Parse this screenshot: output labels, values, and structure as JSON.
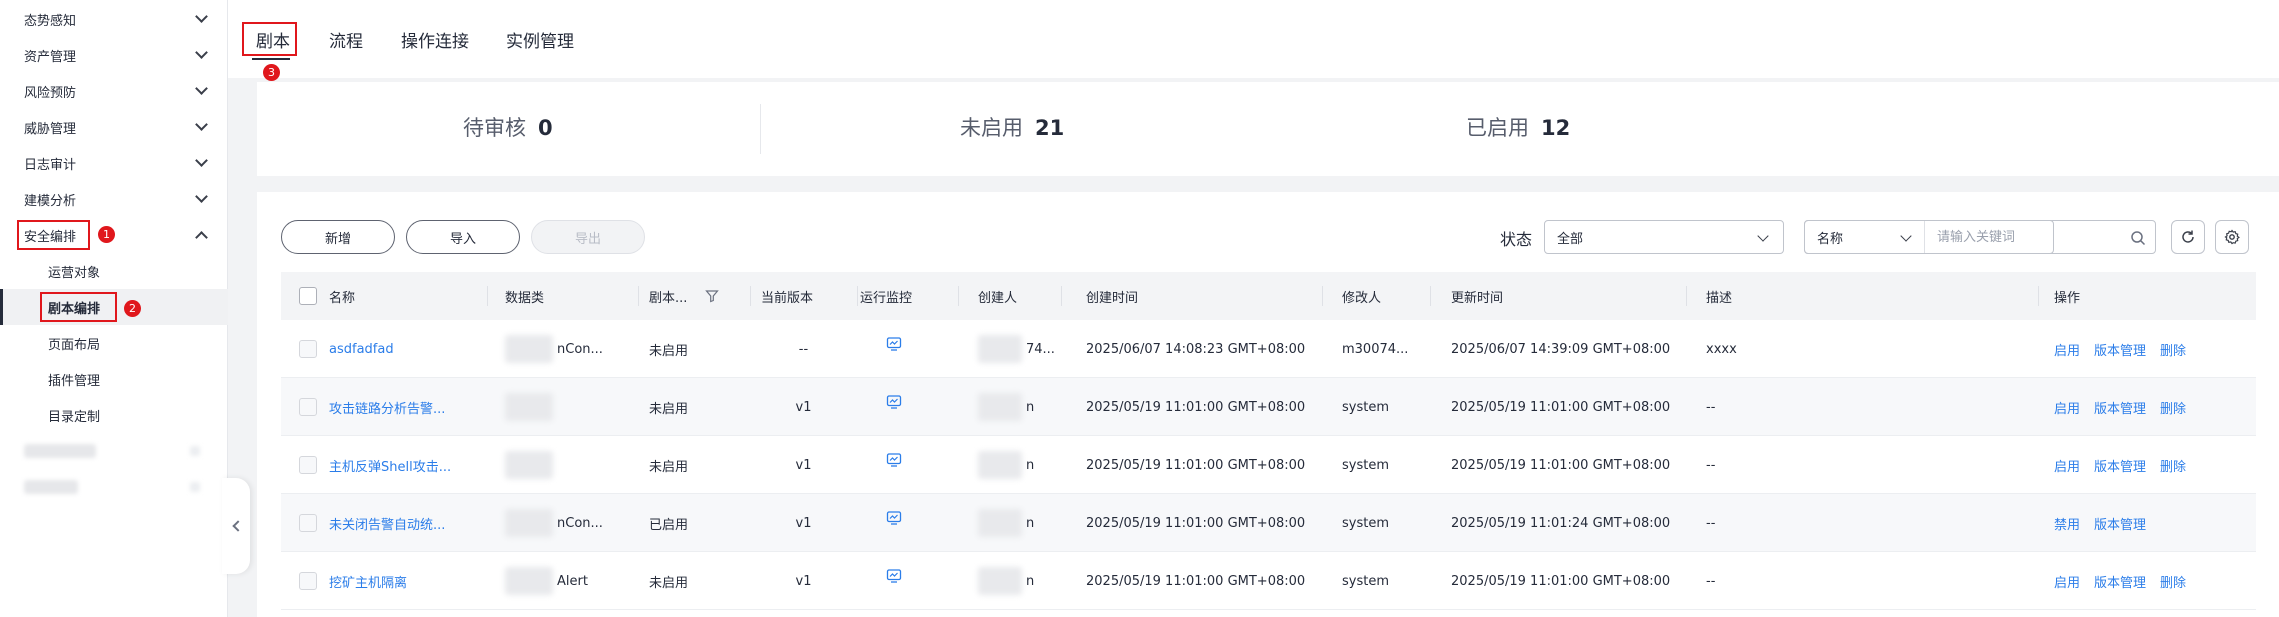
{
  "sidebar": {
    "items": [
      {
        "label": "态势感知"
      },
      {
        "label": "资产管理"
      },
      {
        "label": "风险预防"
      },
      {
        "label": "威胁管理"
      },
      {
        "label": "日志审计"
      },
      {
        "label": "建模分析"
      },
      {
        "label": "安全编排"
      }
    ],
    "subitems": [
      {
        "label": "运营对象"
      },
      {
        "label": "剧本编排"
      },
      {
        "label": "页面布局"
      },
      {
        "label": "插件管理"
      },
      {
        "label": "目录定制"
      }
    ],
    "active_subitem": "剧本编排"
  },
  "annotations": {
    "badge1": "1",
    "badge2": "2",
    "badge3": "3"
  },
  "tabs": [
    {
      "label": "剧本"
    },
    {
      "label": "流程"
    },
    {
      "label": "操作连接"
    },
    {
      "label": "实例管理"
    }
  ],
  "stats": [
    {
      "label": "待审核",
      "value": "0"
    },
    {
      "label": "未启用",
      "value": "21"
    },
    {
      "label": "已启用",
      "value": "12"
    }
  ],
  "toolbar": {
    "add_label": "新增",
    "import_label": "导入",
    "export_label": "导出",
    "status_label": "状态",
    "status_value": "全部",
    "search_field": "名称",
    "search_placeholder": "请输入关键词"
  },
  "table": {
    "headers": [
      "名称",
      "数据类",
      "剧本...",
      "当前版本",
      "运行监控",
      "创建人",
      "创建时间",
      "修改人",
      "更新时间",
      "描述",
      "操作"
    ],
    "rows": [
      {
        "name": "asdfadfad",
        "datatype": "nCon...",
        "status": "未启用",
        "version": "--",
        "creator": "74...",
        "created": "2025/06/07 14:08:23 GMT+08:00",
        "modifier": "m30074...",
        "updated": "2025/06/07 14:39:09 GMT+08:00",
        "desc": "xxxx",
        "ops": [
          "启用",
          "版本管理",
          "删除"
        ]
      },
      {
        "name": "攻击链路分析告警...",
        "datatype": "",
        "status": "未启用",
        "version": "v1",
        "creator": "n",
        "created": "2025/05/19 11:01:00 GMT+08:00",
        "modifier": "system",
        "updated": "2025/05/19 11:01:00 GMT+08:00",
        "desc": "--",
        "ops": [
          "启用",
          "版本管理",
          "删除"
        ]
      },
      {
        "name": "主机反弹Shell攻击...",
        "datatype": "",
        "status": "未启用",
        "version": "v1",
        "creator": "n",
        "created": "2025/05/19 11:01:00 GMT+08:00",
        "modifier": "system",
        "updated": "2025/05/19 11:01:00 GMT+08:00",
        "desc": "--",
        "ops": [
          "启用",
          "版本管理",
          "删除"
        ]
      },
      {
        "name": "未关闭告警自动统...",
        "datatype": "nCon...",
        "status": "已启用",
        "version": "v1",
        "creator": "n",
        "created": "2025/05/19 11:01:00 GMT+08:00",
        "modifier": "system",
        "updated": "2025/05/19 11:01:24 GMT+08:00",
        "desc": "--",
        "ops": [
          "禁用",
          "版本管理"
        ]
      },
      {
        "name": "挖矿主机隔离",
        "datatype": "Alert",
        "status": "未启用",
        "version": "v1",
        "creator": "n",
        "created": "2025/05/19 11:01:00 GMT+08:00",
        "modifier": "system",
        "updated": "2025/05/19 11:01:00 GMT+08:00",
        "desc": "--",
        "ops": [
          "启用",
          "版本管理",
          "删除"
        ]
      }
    ]
  },
  "colors": {
    "link": "#2b7de9",
    "annotation": "#e0171c",
    "text": "#252b3a"
  }
}
